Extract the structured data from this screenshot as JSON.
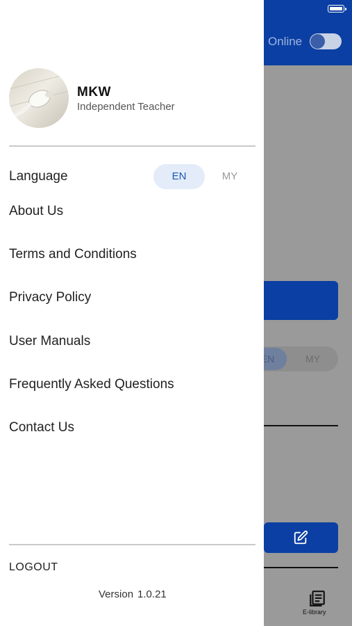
{
  "background": {
    "online_label": "Online",
    "language_toggle": {
      "en": "EN",
      "my": "MY"
    },
    "tab_elibrary": "E-library",
    "edit_icon": "edit-icon",
    "elibrary_icon": "book-icon"
  },
  "drawer": {
    "user": {
      "name": "MKW",
      "role": "Independent Teacher",
      "avatar_icon": "earphones-photo"
    },
    "language": {
      "label": "Language",
      "options": [
        "EN",
        "MY"
      ],
      "selected": "EN"
    },
    "menu": [
      {
        "label": "About Us"
      },
      {
        "label": "Terms and Conditions"
      },
      {
        "label": "Privacy Policy"
      },
      {
        "label": "User Manuals"
      },
      {
        "label": "Frequently Asked Questions"
      },
      {
        "label": "Contact Us"
      }
    ],
    "logout_label": "LOGOUT",
    "version_label": "Version",
    "version_number": "1.0.21"
  },
  "colors": {
    "primary": "#0b3fa3",
    "language_selected_bg": "#e3ecf8",
    "language_selected_text": "#1d58b8",
    "overlay": "#9a9a9a"
  }
}
